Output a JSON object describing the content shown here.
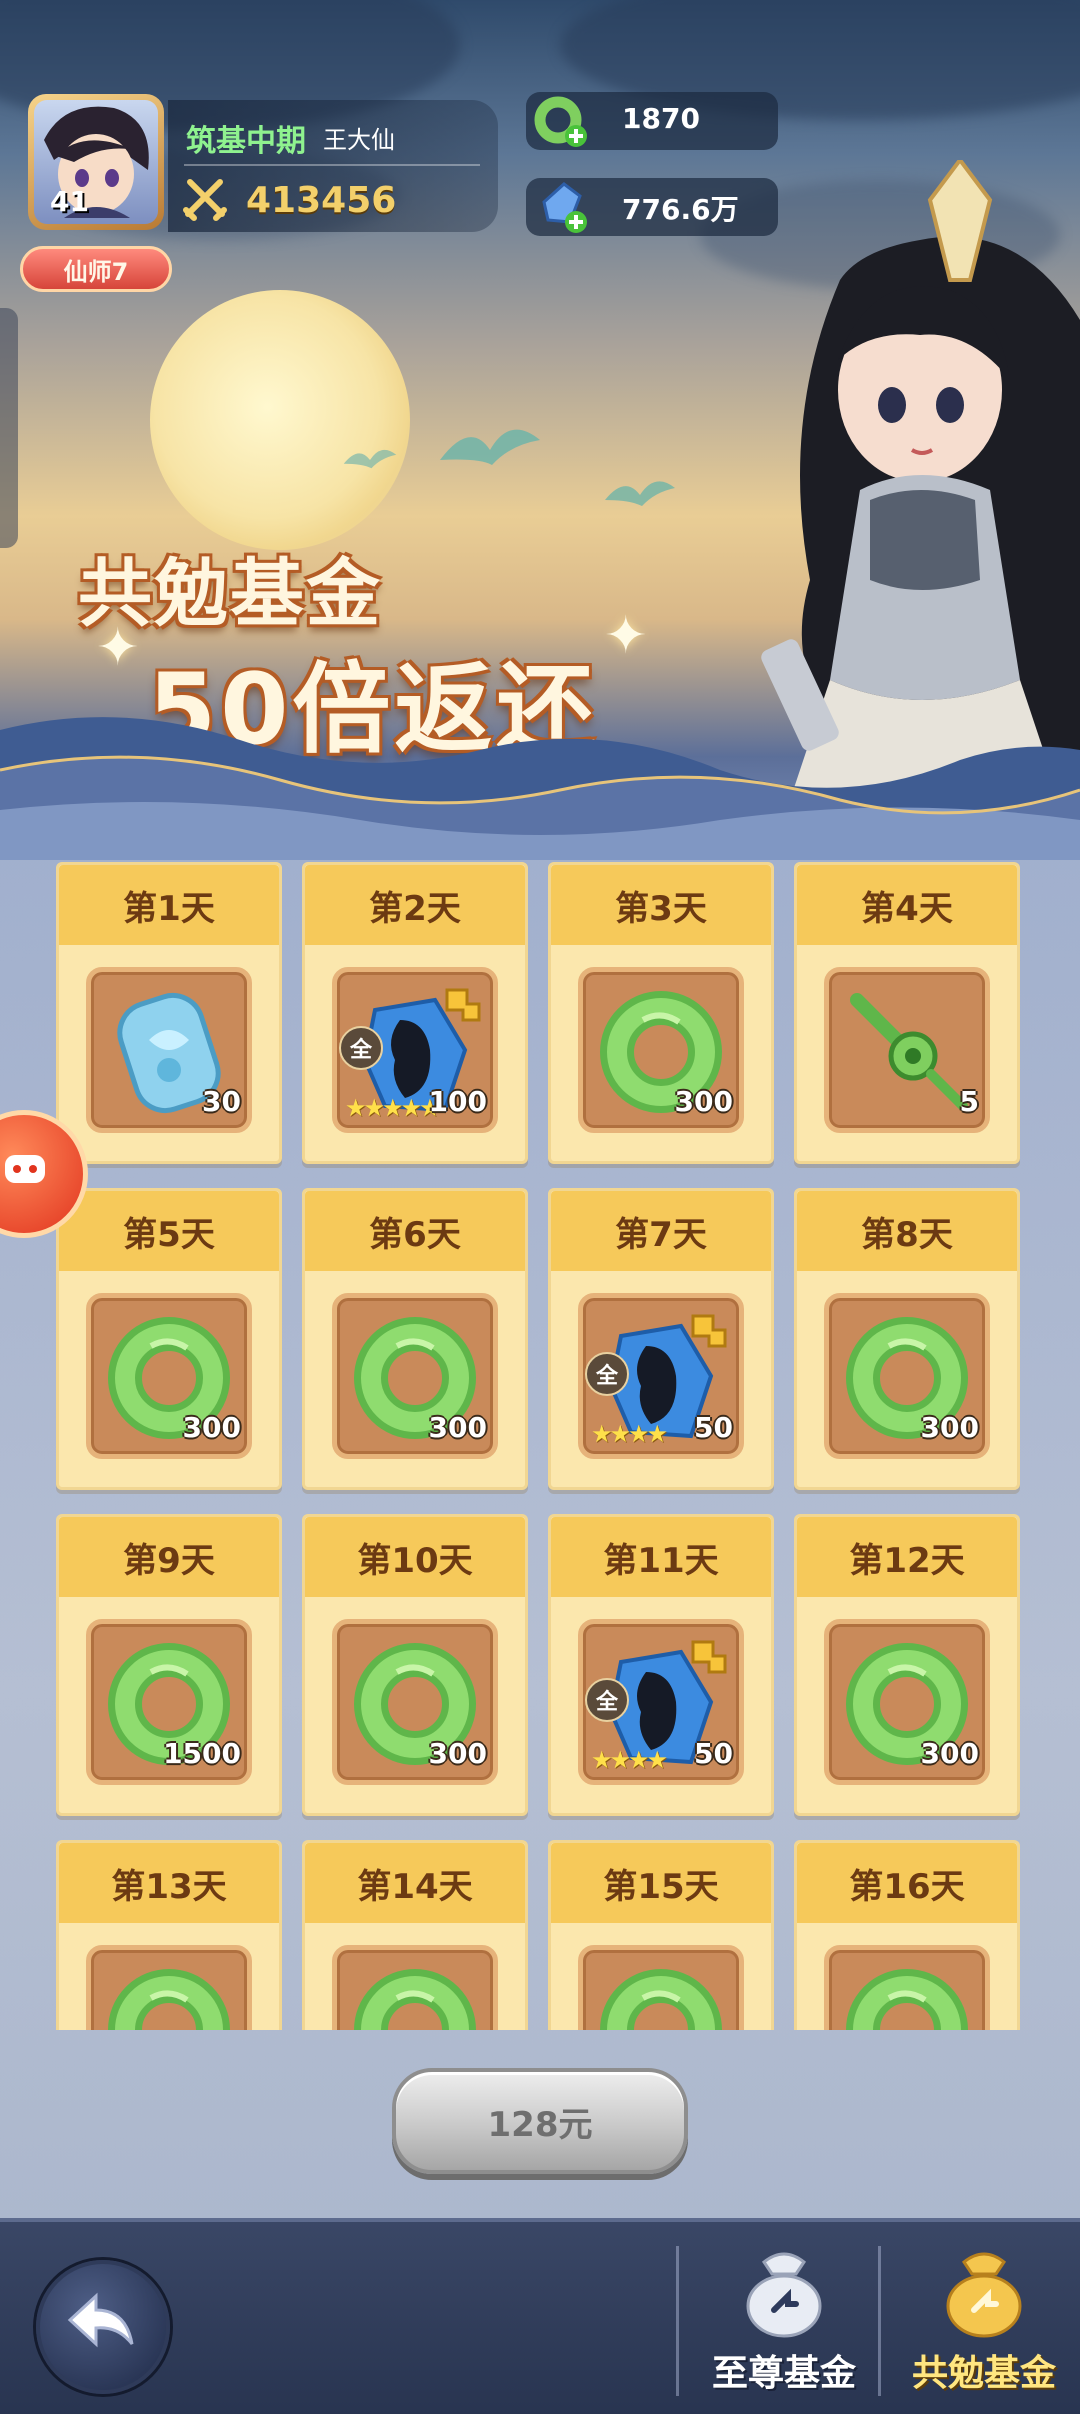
{
  "player": {
    "level": "41",
    "realm": "筑基中期",
    "name": "王大仙",
    "power": "413456",
    "vip": "仙师7"
  },
  "currencies": [
    {
      "icon": "jade-ring-currency-icon",
      "value": "1870"
    },
    {
      "icon": "blue-crystal-currency-icon",
      "value": "776.6万"
    }
  ],
  "banner": {
    "title_line1": "共勉基金",
    "title_line2": "50倍返还"
  },
  "days": [
    {
      "label": "第1天",
      "item": "jade-token",
      "qty": "30"
    },
    {
      "label": "第2天",
      "item": "hero-shard",
      "qty": "100",
      "badge": "全",
      "stars": "★★★★★"
    },
    {
      "label": "第3天",
      "item": "jade-ring",
      "qty": "300"
    },
    {
      "label": "第4天",
      "item": "jade-key",
      "qty": "5"
    },
    {
      "label": "第5天",
      "item": "jade-ring",
      "qty": "300"
    },
    {
      "label": "第6天",
      "item": "jade-ring",
      "qty": "300"
    },
    {
      "label": "第7天",
      "item": "hero-shard",
      "qty": "50",
      "badge": "全",
      "stars": "★★★★"
    },
    {
      "label": "第8天",
      "item": "jade-ring",
      "qty": "300"
    },
    {
      "label": "第9天",
      "item": "jade-ring",
      "qty": "1500"
    },
    {
      "label": "第10天",
      "item": "jade-ring",
      "qty": "300"
    },
    {
      "label": "第11天",
      "item": "hero-shard",
      "qty": "50",
      "badge": "全",
      "stars": "★★★★"
    },
    {
      "label": "第12天",
      "item": "jade-ring",
      "qty": "300"
    },
    {
      "label": "第13天",
      "item": "jade-ring",
      "qty": ""
    },
    {
      "label": "第14天",
      "item": "jade-ring",
      "qty": ""
    },
    {
      "label": "第15天",
      "item": "jade-ring",
      "qty": ""
    },
    {
      "label": "第16天",
      "item": "jade-ring",
      "qty": ""
    }
  ],
  "purchase": {
    "price": "128元"
  },
  "bottom_tabs": [
    {
      "label": "至尊基金"
    },
    {
      "label": "共勉基金"
    }
  ],
  "colors": {
    "card_header": "#f6c95a",
    "card_body": "#fbe7ad",
    "jade_green": "#7fcf5f",
    "active_tab": "#ffe680"
  }
}
